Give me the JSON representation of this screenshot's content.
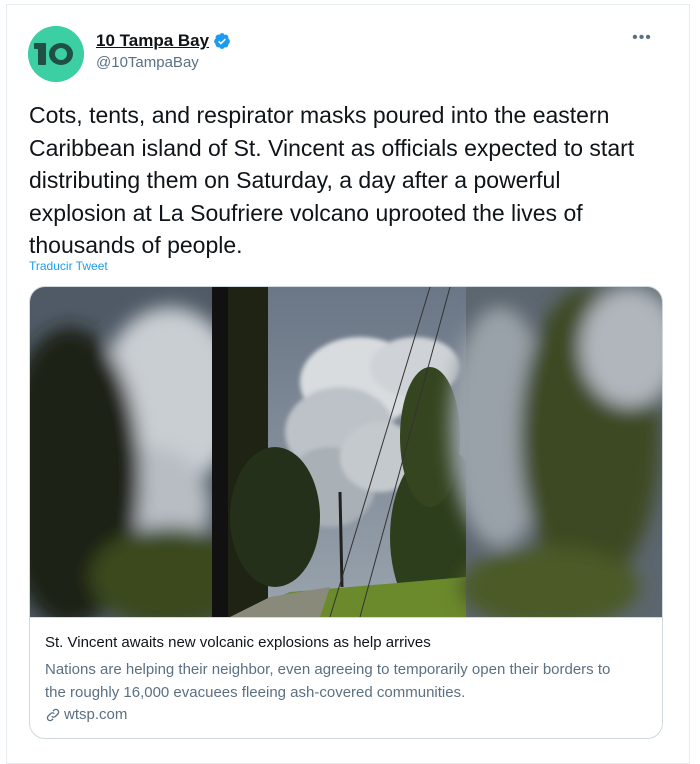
{
  "tweet": {
    "author": {
      "display_name": "10 Tampa Bay",
      "handle": "@10TampaBay",
      "verified": true,
      "avatar_text": "10",
      "avatar_color": "#3ccfa3"
    },
    "more_icon": "more-icon",
    "text": "Cots, tents, and respirator masks poured into the eastern Caribbean island of St. Vincent as officials expected to start distributing them on Saturday, a day after a powerful explosion at La Soufriere volcano uprooted the lives of thousands of people.",
    "translate_label": "Traducir Tweet",
    "card": {
      "title": "St. Vincent awaits new volcanic explosions as help arrives",
      "description": "Nations are helping their neighbor, even agreeing to temporarily open their borders to the roughly 16,000 evacuees fleeing ash-covered communities.",
      "source": "wtsp.com"
    }
  },
  "colors": {
    "accent": "#1d9bf0",
    "secondary_text": "#5b7083",
    "border": "#cfd9de"
  }
}
